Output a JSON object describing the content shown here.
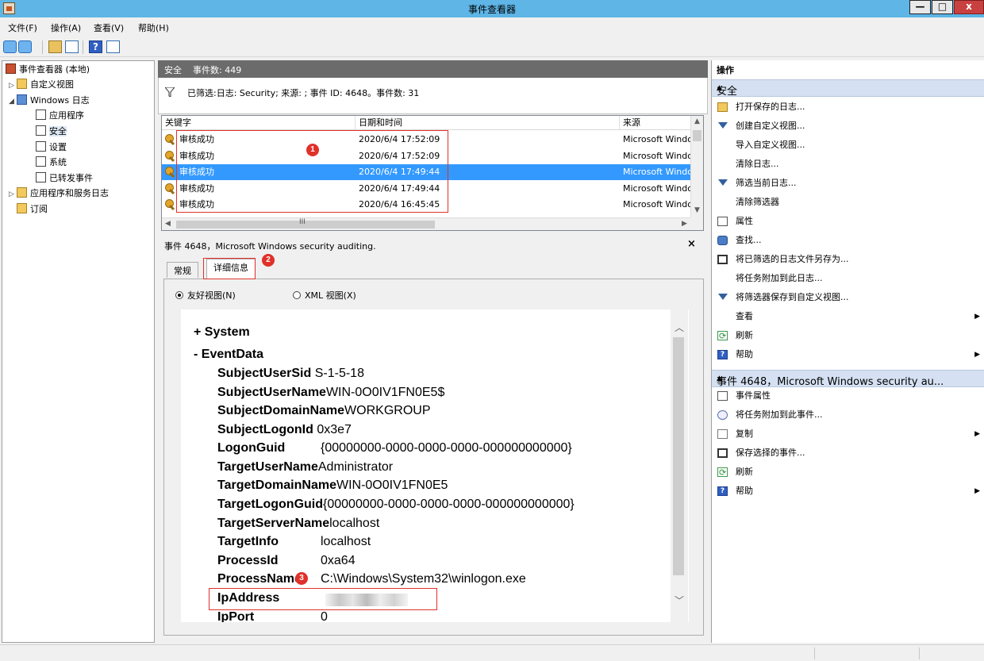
{
  "window": {
    "title": "事件查看器",
    "minimize": "—",
    "maximize": "□",
    "close": "x"
  },
  "menu": [
    "文件(F)",
    "操作(A)",
    "查看(V)",
    "帮助(H)"
  ],
  "toolbar": {
    "help_glyph": "?"
  },
  "tree": {
    "root": "事件查看器 (本地)",
    "custom_views": "自定义视图",
    "windows_logs": "Windows 日志",
    "application": "应用程序",
    "security": "安全",
    "setup": "设置",
    "system": "系统",
    "forwarded": "已转发事件",
    "apps_services": "应用程序和服务日志",
    "subscriptions": "订阅"
  },
  "center": {
    "header_title": "安全",
    "header_count": "事件数: 449",
    "filter_text": "已筛选:日志: Security; 来源: ; 事件 ID: 4648。事件数: 31",
    "columns": [
      "关键字",
      "日期和时间",
      "来源"
    ],
    "rows": [
      {
        "keyword": "审核成功",
        "date": "2020/6/4 17:52:09",
        "source": "Microsoft Windows"
      },
      {
        "keyword": "审核成功",
        "date": "2020/6/4 17:52:09",
        "source": "Microsoft Windows"
      },
      {
        "keyword": "审核成功",
        "date": "2020/6/4 17:49:44",
        "source": "Microsoft Windows"
      },
      {
        "keyword": "审核成功",
        "date": "2020/6/4 17:49:44",
        "source": "Microsoft Windows"
      },
      {
        "keyword": "审核成功",
        "date": "2020/6/4 16:45:45",
        "source": "Microsoft Windows"
      }
    ],
    "hscroll_glyph": "III"
  },
  "detail": {
    "title": "事件 4648，Microsoft Windows security auditing.",
    "close": "×",
    "tab_general": "常规",
    "tab_details": "详细信息",
    "radio_friendly": "友好视图(N)",
    "radio_xml": "XML 视图(X)",
    "system_node": "+ System",
    "eventdata_node": "- EventData",
    "fields": [
      {
        "name": "SubjectUserSid",
        "value": "S-1-5-18"
      },
      {
        "name": "SubjectUserName",
        "value": "WIN-0O0IV1FN0E5$"
      },
      {
        "name": "SubjectDomainName",
        "value": "WORKGROUP"
      },
      {
        "name": "SubjectLogonId",
        "value": "0x3e7"
      },
      {
        "name": "LogonGuid",
        "value": "{00000000-0000-0000-0000-000000000000}"
      },
      {
        "name": "TargetUserName",
        "value": "Administrator"
      },
      {
        "name": "TargetDomainName",
        "value": "WIN-0O0IV1FN0E5"
      },
      {
        "name": "TargetLogonGuid",
        "value": "{00000000-0000-0000-0000-000000000000}"
      },
      {
        "name": "TargetServerName",
        "value": "localhost"
      },
      {
        "name": "TargetInfo",
        "value": "localhost"
      },
      {
        "name": "ProcessId",
        "value": "0xa64"
      },
      {
        "name": "ProcessName",
        "value": "C:\\Windows\\System32\\winlogon.exe"
      },
      {
        "name": "IpAddress",
        "value": ""
      },
      {
        "name": "IpPort",
        "value": "0"
      }
    ]
  },
  "actions": {
    "title": "操作",
    "section1": "安全",
    "section1_items": [
      "打开保存的日志...",
      "创建自定义视图...",
      "导入自定义视图...",
      "清除日志...",
      "筛选当前日志...",
      "清除筛选器",
      "属性",
      "查找...",
      "将已筛选的日志文件另存为...",
      "将任务附加到此日志...",
      "将筛选器保存到自定义视图...",
      "查看",
      "刷新",
      "帮助"
    ],
    "section2": "事件 4648，Microsoft Windows security au...",
    "section2_items": [
      "事件属性",
      "将任务附加到此事件...",
      "复制",
      "保存选择的事件...",
      "刷新",
      "帮助"
    ]
  },
  "annotations": [
    "1",
    "2",
    "3"
  ],
  "colors": {
    "titlebar": "#5eb5e6",
    "selection": "#3399ff",
    "header": "#6b6b6b",
    "action_section": "#d5e1f2",
    "annotation": "#e0312a"
  }
}
